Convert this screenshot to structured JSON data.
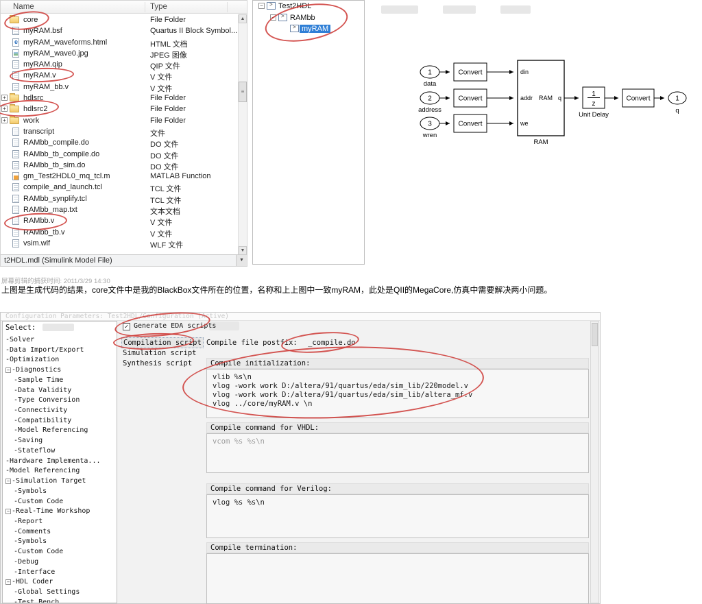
{
  "explorer": {
    "columns": {
      "name": "Name",
      "type": "Type"
    },
    "rows": [
      {
        "name": "core",
        "type": "File Folder",
        "icon": "folder",
        "expander": false
      },
      {
        "name": "myRAM.bsf",
        "type": "Quartus II Block Symbol...",
        "icon": "file",
        "expander": false
      },
      {
        "name": "myRAM_waveforms.html",
        "type": "HTML 文档",
        "icon": "html",
        "expander": false
      },
      {
        "name": "myRAM_wave0.jpg",
        "type": "JPEG 图像",
        "icon": "image",
        "expander": false
      },
      {
        "name": "myRAM.qip",
        "type": "QIP 文件",
        "icon": "file",
        "expander": false
      },
      {
        "name": "myRAM.v",
        "type": "V 文件",
        "icon": "file",
        "expander": false
      },
      {
        "name": "myRAM_bb.v",
        "type": "V 文件",
        "icon": "file",
        "expander": false
      },
      {
        "name": "hdlsrc",
        "type": "File Folder",
        "icon": "folder",
        "expander": true
      },
      {
        "name": "hdlsrc2",
        "type": "File Folder",
        "icon": "folder",
        "expander": true
      },
      {
        "name": "work",
        "type": "File Folder",
        "icon": "folder",
        "expander": true
      },
      {
        "name": "transcript",
        "type": "文件",
        "icon": "file",
        "expander": false
      },
      {
        "name": "RAMbb_compile.do",
        "type": "DO 文件",
        "icon": "file",
        "expander": false
      },
      {
        "name": "RAMbb_tb_compile.do",
        "type": "DO 文件",
        "icon": "file",
        "expander": false
      },
      {
        "name": "RAMbb_tb_sim.do",
        "type": "DO 文件",
        "icon": "file",
        "expander": false
      },
      {
        "name": "gm_Test2HDL0_mq_tcl.m",
        "type": "MATLAB Function",
        "icon": "matlab",
        "expander": false
      },
      {
        "name": "compile_and_launch.tcl",
        "type": "TCL 文件",
        "icon": "file",
        "expander": false
      },
      {
        "name": "RAMbb_synplify.tcl",
        "type": "TCL 文件",
        "icon": "file",
        "expander": false
      },
      {
        "name": "RAMbb_map.txt",
        "type": "文本文档",
        "icon": "file",
        "expander": false
      },
      {
        "name": "RAMbb.v",
        "type": "V 文件",
        "icon": "file",
        "expander": false
      },
      {
        "name": "RAMbb_tb.v",
        "type": "V 文件",
        "icon": "file",
        "expander": false
      },
      {
        "name": "vsim.wlf",
        "type": "WLF 文件",
        "icon": "file",
        "expander": false
      }
    ],
    "status": "t2HDL.mdl (Simulink Model File)"
  },
  "model_tree": {
    "items": [
      {
        "label": "Test2HDL",
        "depth": 0,
        "expander": true,
        "selected": false
      },
      {
        "label": "RAMbb",
        "depth": 1,
        "expander": true,
        "selected": false
      },
      {
        "label": "myRAM",
        "depth": 2,
        "expander": false,
        "selected": true
      }
    ]
  },
  "diagram": {
    "inports": [
      {
        "num": "1",
        "label": "data"
      },
      {
        "num": "2",
        "label": "address"
      },
      {
        "num": "3",
        "label": "wren"
      }
    ],
    "convert_label": "Convert",
    "ram": {
      "in_ports": [
        "din",
        "addr",
        "we"
      ],
      "out_port": "q",
      "inner_label": "RAM",
      "block_label": "RAM"
    },
    "unit_delay": {
      "numerator": "1",
      "denominator": "z",
      "label": "Unit Delay"
    },
    "outport": {
      "num": "1",
      "label": "q"
    }
  },
  "captions": {
    "timestamp": "屏幕剪辑的捕获时间: 2011/3/29 14:30",
    "note": "上图是生成代码的结果，core文件中是我的BlackBox文件所在的位置，名称和上上图中一致myRAM，此处是QII的MegaCore,仿真中需要解决两小问题。"
  },
  "dialog": {
    "title": "Configuration Parameters: Test2HDL/Configuration (Active)",
    "select_label": "Select:",
    "tree": [
      {
        "label": "Solver",
        "depth": 0,
        "expander": false
      },
      {
        "label": "Data Import/Export",
        "depth": 0,
        "expander": false
      },
      {
        "label": "Optimization",
        "depth": 0,
        "expander": false
      },
      {
        "label": "Diagnostics",
        "depth": 0,
        "expander": true
      },
      {
        "label": "Sample Time",
        "depth": 1,
        "expander": false
      },
      {
        "label": "Data Validity",
        "depth": 1,
        "expander": false
      },
      {
        "label": "Type Conversion",
        "depth": 1,
        "expander": false
      },
      {
        "label": "Connectivity",
        "depth": 1,
        "expander": false
      },
      {
        "label": "Compatibility",
        "depth": 1,
        "expander": false
      },
      {
        "label": "Model Referencing",
        "depth": 1,
        "expander": false
      },
      {
        "label": "Saving",
        "depth": 1,
        "expander": false
      },
      {
        "label": "Stateflow",
        "depth": 1,
        "expander": false
      },
      {
        "label": "Hardware Implementa...",
        "depth": 0,
        "expander": false
      },
      {
        "label": "Model Referencing",
        "depth": 0,
        "expander": false
      },
      {
        "label": "Simulation Target",
        "depth": 0,
        "expander": true
      },
      {
        "label": "Symbols",
        "depth": 1,
        "expander": false
      },
      {
        "label": "Custom Code",
        "depth": 1,
        "expander": false
      },
      {
        "label": "Real-Time Workshop",
        "depth": 0,
        "expander": true
      },
      {
        "label": "Report",
        "depth": 1,
        "expander": false
      },
      {
        "label": "Comments",
        "depth": 1,
        "expander": false
      },
      {
        "label": "Symbols",
        "depth": 1,
        "expander": false
      },
      {
        "label": "Custom Code",
        "depth": 1,
        "expander": false
      },
      {
        "label": "Debug",
        "depth": 1,
        "expander": false
      },
      {
        "label": "Interface",
        "depth": 1,
        "expander": false
      },
      {
        "label": "HDL Coder",
        "depth": 0,
        "expander": true
      },
      {
        "label": "Global Settings",
        "depth": 1,
        "expander": false
      },
      {
        "label": "Test Bench",
        "depth": 1,
        "expander": false
      }
    ],
    "generate_checkbox_label": "Generate EDA scripts",
    "generate_checked": true,
    "scripts": [
      "Compilation script",
      "Simulation script",
      "Synthesis script"
    ],
    "fields": {
      "postfix_label": "Compile file postfix:",
      "postfix_value": "_compile.do",
      "init_label": "Compile initialization:",
      "init_lines": [
        "vlib %s\\n",
        "vlog -work work D:/altera/91/quartus/eda/sim_lib/220model.v",
        "vlog -work work D:/altera/91/quartus/eda/sim_lib/altera_mf.v",
        "vlog ../core/myRAM.v \\n"
      ],
      "vhdl_label": "Compile command for VHDL:",
      "vhdl_value": "vcom %s %s\\n",
      "verilog_label": "Compile command for Verilog:",
      "verilog_value": "vlog %s %s\\n",
      "termination_label": "Compile termination:",
      "termination_value": ""
    }
  }
}
